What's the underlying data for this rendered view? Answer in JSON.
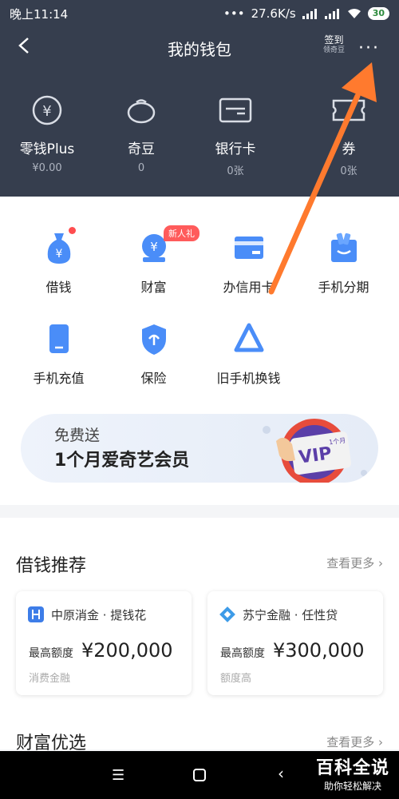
{
  "status": {
    "time": "晚上11:14",
    "speed": "27.6K/s",
    "battery": "30"
  },
  "header": {
    "title": "我的钱包",
    "signin_label": "签到",
    "signin_sub": "领奇豆",
    "more": "···",
    "items": [
      {
        "label": "零钱Plus",
        "value": "¥0.00",
        "icon": "yen-circle-icon"
      },
      {
        "label": "奇豆",
        "value": "0",
        "icon": "bean-icon"
      },
      {
        "label": "银行卡",
        "value": "0张",
        "icon": "bank-card-icon"
      },
      {
        "label": "券",
        "value": "0张",
        "icon": "coupon-icon"
      }
    ]
  },
  "services": {
    "row1": [
      {
        "label": "借钱",
        "icon": "money-bag-icon"
      },
      {
        "label": "财富",
        "icon": "wealth-icon",
        "badge": "新人礼"
      },
      {
        "label": "办信用卡",
        "icon": "credit-card-icon"
      },
      {
        "label": "手机分期",
        "icon": "shopping-bag-icon"
      }
    ],
    "row2": [
      {
        "label": "手机充值",
        "icon": "phone-icon"
      },
      {
        "label": "保险",
        "icon": "shield-icon"
      },
      {
        "label": "旧手机换钱",
        "icon": "recycle-icon"
      }
    ]
  },
  "banner": {
    "line1": "免费送",
    "line2": "1个月爱奇艺会员",
    "vip_text": "VIP",
    "vip_sub": "1个月"
  },
  "loans": {
    "title": "借钱推荐",
    "more": "查看更多",
    "cards": [
      {
        "name": "中原消金 · 提钱花",
        "amount_label": "最高额度",
        "amount": "¥200,000",
        "sub": "消费金融"
      },
      {
        "name": "苏宁金融 · 任性贷",
        "amount_label": "最高额度",
        "amount": "¥300,000",
        "sub": "额度高"
      }
    ]
  },
  "wealth": {
    "title": "财富优选",
    "more": "查看更多"
  },
  "watermark": {
    "title": "百科全说",
    "subtitle": "助你轻松解决"
  },
  "colors": {
    "header_bg": "#363e4e",
    "accent_blue": "#4a8df8",
    "arrow": "#ff7a2e"
  }
}
